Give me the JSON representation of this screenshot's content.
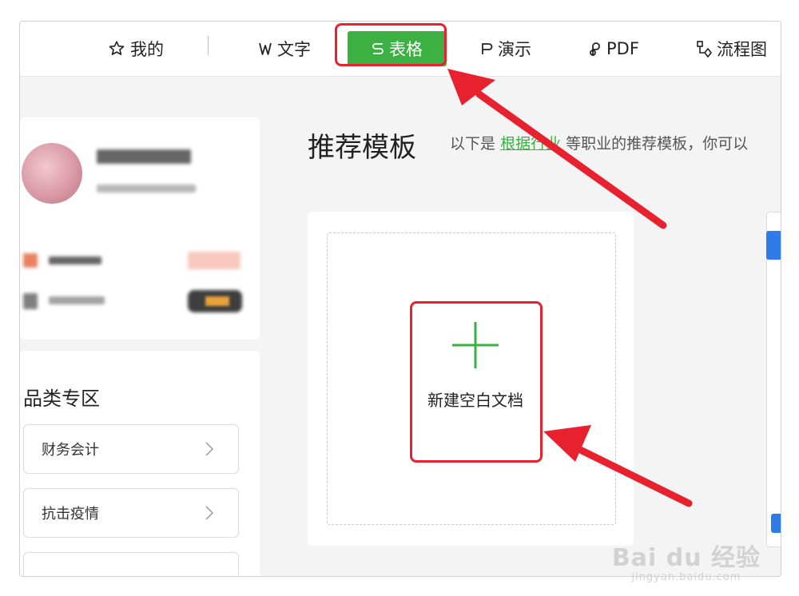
{
  "nav": {
    "tabs": [
      {
        "label": "我的",
        "icon": "star-icon"
      },
      {
        "label": "文字",
        "icon": "writer-icon"
      },
      {
        "label": "表格",
        "icon": "spreadsheet-icon",
        "active": true
      },
      {
        "label": "演示",
        "icon": "presentation-icon"
      },
      {
        "label": "PDF",
        "icon": "pdf-icon"
      },
      {
        "label": "流程图",
        "icon": "flowchart-icon"
      }
    ],
    "active_color": "#3cb043"
  },
  "categories": {
    "title": "品类专区",
    "items": [
      {
        "label": "财务会计"
      },
      {
        "label": "抗击疫情"
      }
    ]
  },
  "recommend": {
    "title": "推荐模板",
    "subtitle_prefix": "以下是",
    "subtitle_link": "根据行业",
    "subtitle_suffix": "等职业的推荐模板，你可以"
  },
  "new_blank": {
    "label": "新建空白文档"
  },
  "annotations": {
    "highlight_color": "#e8212f"
  },
  "watermark": {
    "main": "Bai du 经验",
    "sub": "jingyan.baidu.com"
  }
}
